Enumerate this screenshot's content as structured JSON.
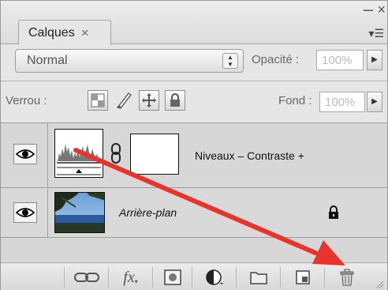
{
  "panel": {
    "tab_label": "Calques",
    "tab_close_glyph": "×",
    "minimize_glyph": "–",
    "close_glyph": "×",
    "menu_glyph": "▾☰"
  },
  "blend": {
    "mode": "Normal",
    "opacity_label": "Opacité :",
    "opacity_value": "100%"
  },
  "lock": {
    "label": "Verrou :",
    "fill_label": "Fond :",
    "fill_value": "100%",
    "icons": [
      "transparency-lock-icon",
      "brush-lock-icon",
      "move-lock-icon",
      "padlock-icon"
    ]
  },
  "layers": [
    {
      "name": "Niveaux – Contraste +",
      "type": "adjustment",
      "visible": true
    },
    {
      "name": "Arrière-plan",
      "type": "background",
      "visible": true,
      "locked": true
    }
  ],
  "footer": {
    "buttons": [
      "link-layers-icon",
      "fx-icon",
      "add-mask-icon",
      "adjustment-layer-icon",
      "new-group-icon",
      "new-layer-icon",
      "trash-icon"
    ],
    "fx_label": "fx"
  },
  "colors": {
    "annotation_arrow": "#e8352b",
    "panel_bg": "#e6e6e6",
    "list_bg": "#d7d7d7"
  }
}
